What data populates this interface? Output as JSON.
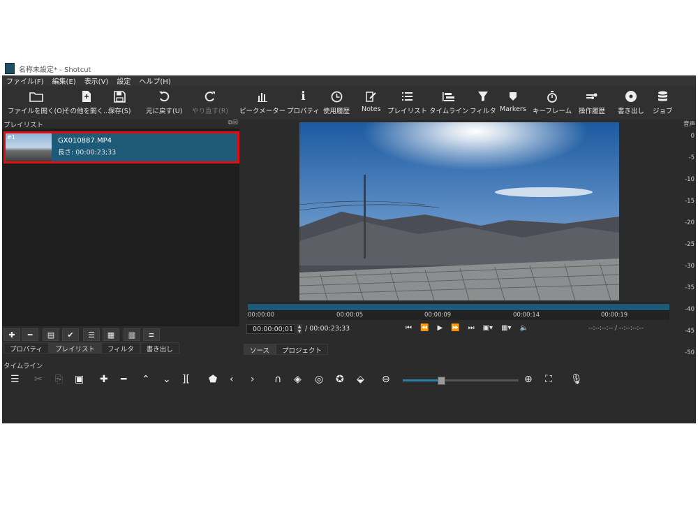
{
  "window": {
    "title": "名称未設定* - Shotcut"
  },
  "menu": [
    "ファイル(F)",
    "編集(E)",
    "表示(V)",
    "設定",
    "ヘルプ(H)"
  ],
  "toolbar": {
    "open_file": "ファイルを開く(O)",
    "open_other": "その他を開く...",
    "save": "保存(S)",
    "undo": "元に戻す(U)",
    "redo": "やり直す(R)",
    "peak_meter": "ピークメーター",
    "properties": "プロパティ",
    "history": "使用履歴",
    "notes": "Notes",
    "playlist": "プレイリスト",
    "timeline": "タイムライン",
    "filters": "フィルタ",
    "markers": "Markers",
    "keyframes": "キーフレーム",
    "ops_history": "操作履歴",
    "export": "書き出し",
    "jobs": "ジョブ"
  },
  "playlist": {
    "title": "プレイリスト",
    "items": [
      {
        "number": "#1",
        "name": "GX010887.MP4",
        "duration": "長さ: 00:00:23;33"
      }
    ],
    "tabs": [
      "プロパティ",
      "プレイリスト",
      "フィルタ",
      "書き出し"
    ]
  },
  "player": {
    "ruler_ticks": [
      "00:00:00",
      "00:00:05",
      "00:00:09",
      "00:00:14",
      "00:00:19"
    ],
    "current_time": "00:00:00;01",
    "total_time": "/ 00:00:23;33",
    "in_out": "--:--:--:-- /   --:--:--:--",
    "tabs": [
      "ソース",
      "プロジェクト"
    ]
  },
  "meter": {
    "title": "音声",
    "marks": [
      "0",
      "-5",
      "-10",
      "-15",
      "-20",
      "-25",
      "-30",
      "-35",
      "-40",
      "-45",
      "-50"
    ]
  },
  "timeline": {
    "title": "タイムライン"
  },
  "colors": {
    "accent": "#1c5a78",
    "highlight_border": "#e01010",
    "background": "#2b2b2b"
  }
}
